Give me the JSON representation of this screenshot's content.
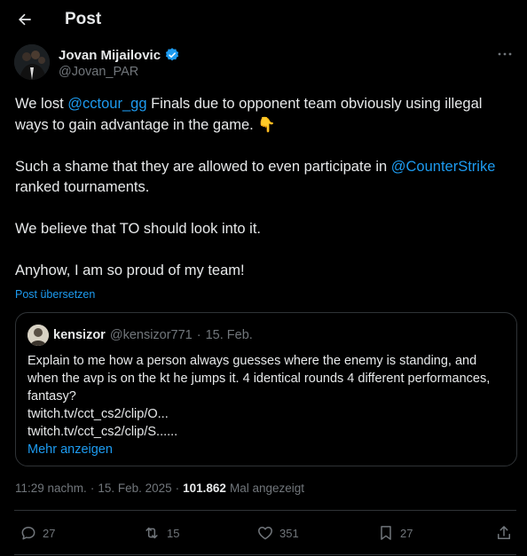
{
  "header": {
    "title": "Post",
    "back_icon": "arrow-left-icon"
  },
  "author": {
    "name": "Jovan Mijailovic",
    "handle": "@Jovan_PAR",
    "verified_icon": "verified-badge-icon",
    "more_icon": "more-options-icon"
  },
  "post": {
    "line1_pre": "We lost ",
    "line1_mention": "@cctour_gg",
    "line1_post": " Finals due to opponent team obviously using illegal ways to gain advantage in the game. ",
    "line1_emoji": "👇",
    "line2_pre": "Such a shame that they are allowed to even participate in ",
    "line2_mention": "@CounterStrike",
    "line2_post": " ranked tournaments.",
    "line3": "We believe that TO should look into it.",
    "line4": "Anyhow, I am so proud of my team!"
  },
  "translate_label": "Post übersetzen",
  "quote": {
    "name": "kensizor",
    "handle": "@kensizor771",
    "separator": "·",
    "date": "15. Feb.",
    "text": "Explain to me how a person always guesses where the enemy is standing, and when the avp is on the kt he jumps it. 4 identical rounds 4 different performances, fantasy?",
    "link1": "twitch.tv/cct_cs2/clip/O...",
    "link2": "twitch.tv/cct_cs2/clip/S......",
    "show_more": "Mehr anzeigen"
  },
  "meta": {
    "time": "11:29 nachm.",
    "separator1": "·",
    "date": "15. Feb. 2025",
    "separator2": "·",
    "views": "101.862",
    "views_label": "Mal angezeigt"
  },
  "actions": {
    "replies": "27",
    "reposts": "15",
    "likes": "351",
    "bookmarks": "27"
  },
  "colors": {
    "accent": "#1d9bf0",
    "muted": "#71767b",
    "text": "#e7e9ea",
    "border": "#2f3336",
    "background": "#000000"
  }
}
